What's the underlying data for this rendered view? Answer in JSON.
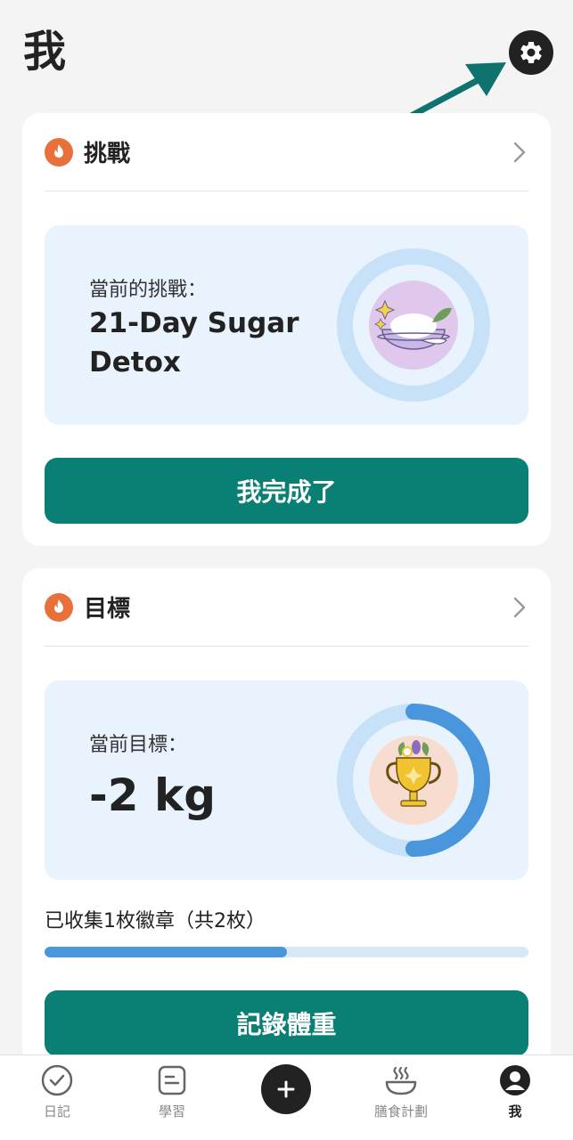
{
  "page": {
    "title": "我"
  },
  "challenge": {
    "title": "挑戰",
    "current_label": "當前的挑戰：",
    "current_name": "21-Day Sugar Detox",
    "button_label": "我完成了"
  },
  "goal": {
    "title": "目標",
    "current_label": "當前目標：",
    "current_value": "-2 kg",
    "badge_text": "已收集1枚徽章（共2枚）",
    "badges_collected": 1,
    "badges_total": 2,
    "progress_fraction": 0.5,
    "ring_progress_fraction": 0.5,
    "button_label": "記錄體重"
  },
  "tabbar": {
    "items": [
      {
        "label": "日記",
        "icon": "check-circle-icon"
      },
      {
        "label": "學習",
        "icon": "notes-icon"
      },
      {
        "label": "",
        "icon": "plus-icon"
      },
      {
        "label": "膳食計劃",
        "icon": "bowl-icon"
      },
      {
        "label": "我",
        "icon": "user-icon"
      }
    ]
  },
  "colors": {
    "accent": "#0a8074",
    "flame": "#e8703a",
    "panel": "#e8f3fd",
    "ring": "#c6e1f8",
    "ring_progress": "#4a96dc"
  }
}
